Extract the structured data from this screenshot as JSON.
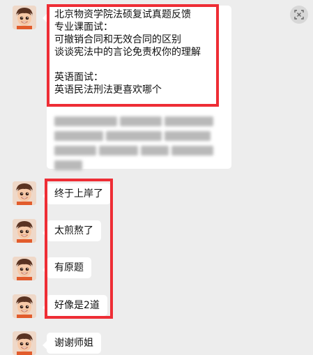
{
  "messages": [
    {
      "id": "m1",
      "lines": [
        "北京物资学院法硕复试真题反馈",
        "专业课面试：",
        "可撤销合同和无效合同的区别",
        "谈谈宪法中的言论免责权你的理解",
        "",
        "英语面试：",
        "英语民法刑法更喜欢哪个"
      ],
      "has_blurred_content": true
    },
    {
      "id": "m2",
      "text": "终于上岸了"
    },
    {
      "id": "m3",
      "text": "太煎熬了"
    },
    {
      "id": "m4",
      "text": "有原题"
    },
    {
      "id": "m5",
      "text": "好像是2道"
    },
    {
      "id": "m6",
      "text": "谢谢师姐"
    }
  ],
  "icons": {
    "avatar": "cartoon-avatar-icon",
    "top_right": "close-screen-icon"
  },
  "colors": {
    "background": "#ededed",
    "bubble": "#ffffff",
    "highlight": "#ee2d35"
  }
}
